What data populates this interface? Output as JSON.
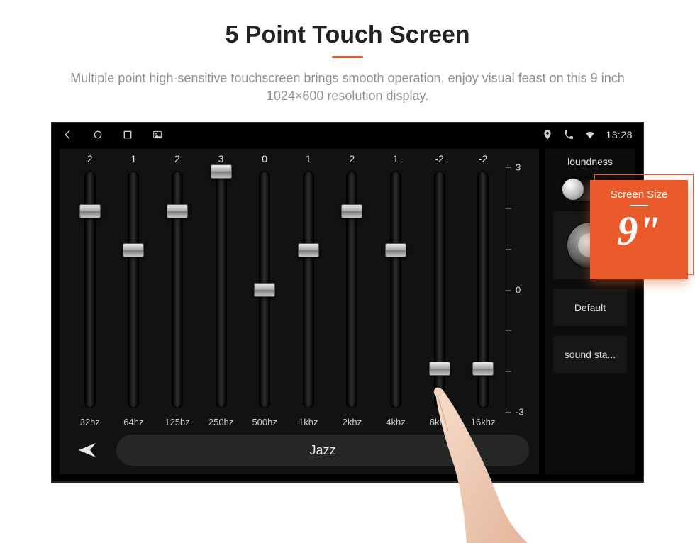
{
  "hero": {
    "title": "5 Point Touch Screen",
    "subtitle": "Multiple point high-sensitive touchscreen brings smooth operation, enjoy visual feast on this 9 inch 1024×600 resolution display."
  },
  "statusbar": {
    "time": "13:28"
  },
  "eq": {
    "scale": {
      "max": 3,
      "min": -3,
      "zero": 0
    },
    "bands": [
      {
        "freq": "32hz",
        "value": 2
      },
      {
        "freq": "64hz",
        "value": 1
      },
      {
        "freq": "125hz",
        "value": 2
      },
      {
        "freq": "250hz",
        "value": 3
      },
      {
        "freq": "500hz",
        "value": 0
      },
      {
        "freq": "1khz",
        "value": 1
      },
      {
        "freq": "2khz",
        "value": 2
      },
      {
        "freq": "4khz",
        "value": 1
      },
      {
        "freq": "8khz",
        "value": -2
      },
      {
        "freq": "16khz",
        "value": -2
      }
    ],
    "preset": "Jazz"
  },
  "side": {
    "loudness_label": "loundness",
    "loudness_on": false,
    "default_label": "Default",
    "soundstage_label": "sound sta..."
  },
  "badge": {
    "label": "Screen Size",
    "value": "9\""
  }
}
